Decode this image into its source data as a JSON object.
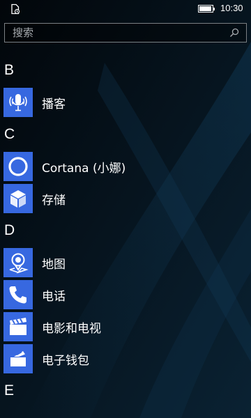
{
  "status_bar": {
    "time": "10:30",
    "battery_level": 0.95
  },
  "search": {
    "placeholder": "搜索",
    "value": ""
  },
  "app_list": {
    "sections": [
      {
        "letter": "B",
        "apps": [
          {
            "label": "播客",
            "icon": "podcast-microphone-icon"
          }
        ]
      },
      {
        "letter": "C",
        "apps": [
          {
            "label": "Cortana (小娜)",
            "icon": "cortana-ring-icon"
          },
          {
            "label": "存储",
            "icon": "storage-cube-icon"
          }
        ]
      },
      {
        "letter": "D",
        "apps": [
          {
            "label": "地图",
            "icon": "map-pin-icon"
          },
          {
            "label": "电话",
            "icon": "phone-handset-icon"
          },
          {
            "label": "电影和电视",
            "icon": "clapperboard-icon"
          },
          {
            "label": "电子钱包",
            "icon": "wallet-icon"
          }
        ]
      },
      {
        "letter": "E",
        "apps": []
      }
    ]
  },
  "colors": {
    "tile_accent": "#3768e0",
    "background": "#03090f"
  }
}
